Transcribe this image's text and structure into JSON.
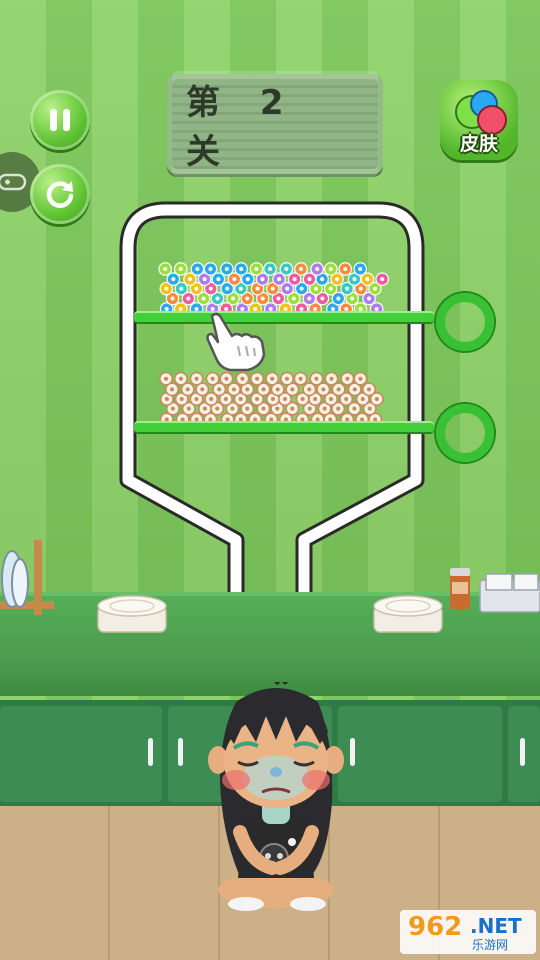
{
  "hud": {
    "level_label": "第 2 关",
    "skin_label": "皮肤",
    "pause_icon": "pause-icon",
    "restart_icon": "restart-icon",
    "side_tab_icon": "gamepad-icon"
  },
  "watermark": {
    "number": "962",
    "suffix": ".NET",
    "site": "乐游网"
  },
  "colors": {
    "accent_green": "#44cf3a",
    "wall_green": "#8fd36a",
    "counter_green": "#4a9a4d",
    "pin_ring": "#39c034"
  }
}
